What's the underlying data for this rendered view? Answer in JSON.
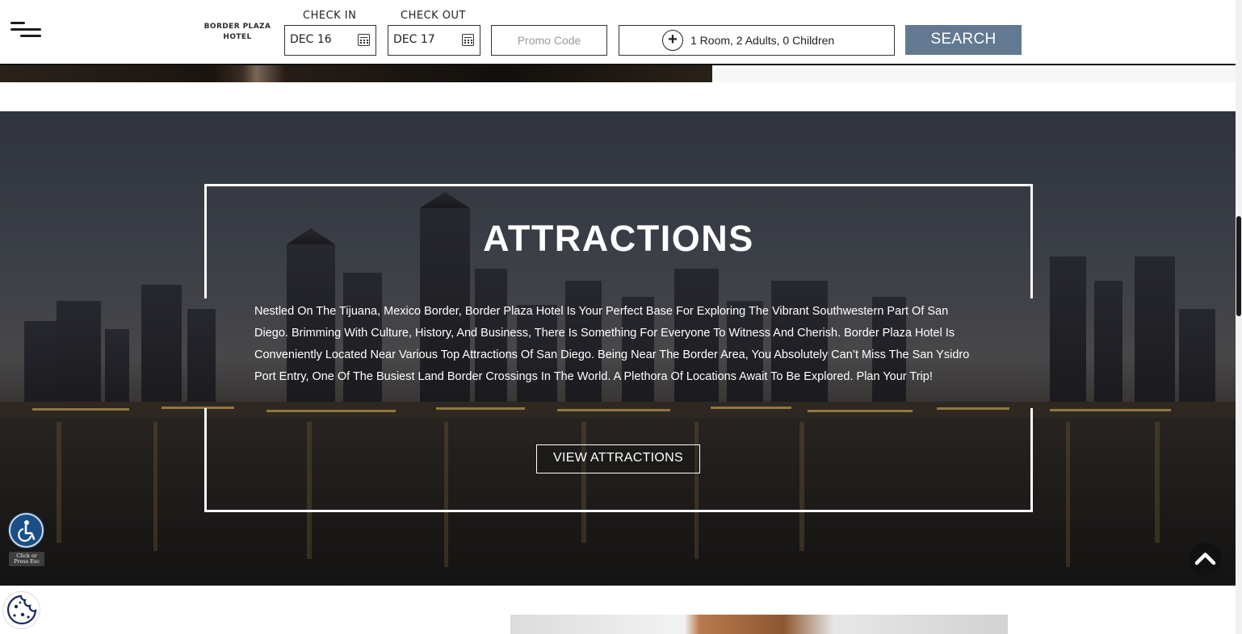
{
  "header": {
    "logo_line1": "BORDER PLAZA",
    "logo_line2": "HOTEL",
    "check_in_label": "CHECK IN",
    "check_in_value": "DEC 16",
    "check_out_label": "CHECK OUT",
    "check_out_value": "DEC 17",
    "promo_placeholder": "Promo Code",
    "guests_value": "1 Room, 2 Adults, 0 Children",
    "search_label": "SEARCH"
  },
  "attractions": {
    "title": "ATTRACTIONS",
    "body": "Nestled On The Tijuana, Mexico Border, Border Plaza Hotel Is Your Perfect Base For Exploring The Vibrant Southwestern Part Of San Diego. Brimming With Culture, History, And Business, There Is Something For Everyone To Witness And Cherish. Border Plaza Hotel Is Conveniently Located Near Various Top Attractions Of San Diego. Being Near The Border Area, You Absolutely Can’t Miss The San Ysidro Port Entry, One Of The Busiest Land Border Crossings In The World. A Plethora Of Locations Await To Be Explored. Plan Your Trip!",
    "button_label": "VIEW ATTRACTIONS"
  },
  "widgets": {
    "accessibility_hint": "Click or Press Esc",
    "accessibility_icon": "wheelchair-icon",
    "cookie_icon": "cookie-icon",
    "scroll_top_icon": "chevron-up-icon"
  },
  "colors": {
    "search_button": "#627992",
    "accessibility_button": "#1a4f86",
    "scroll_top_button": "#111111"
  }
}
